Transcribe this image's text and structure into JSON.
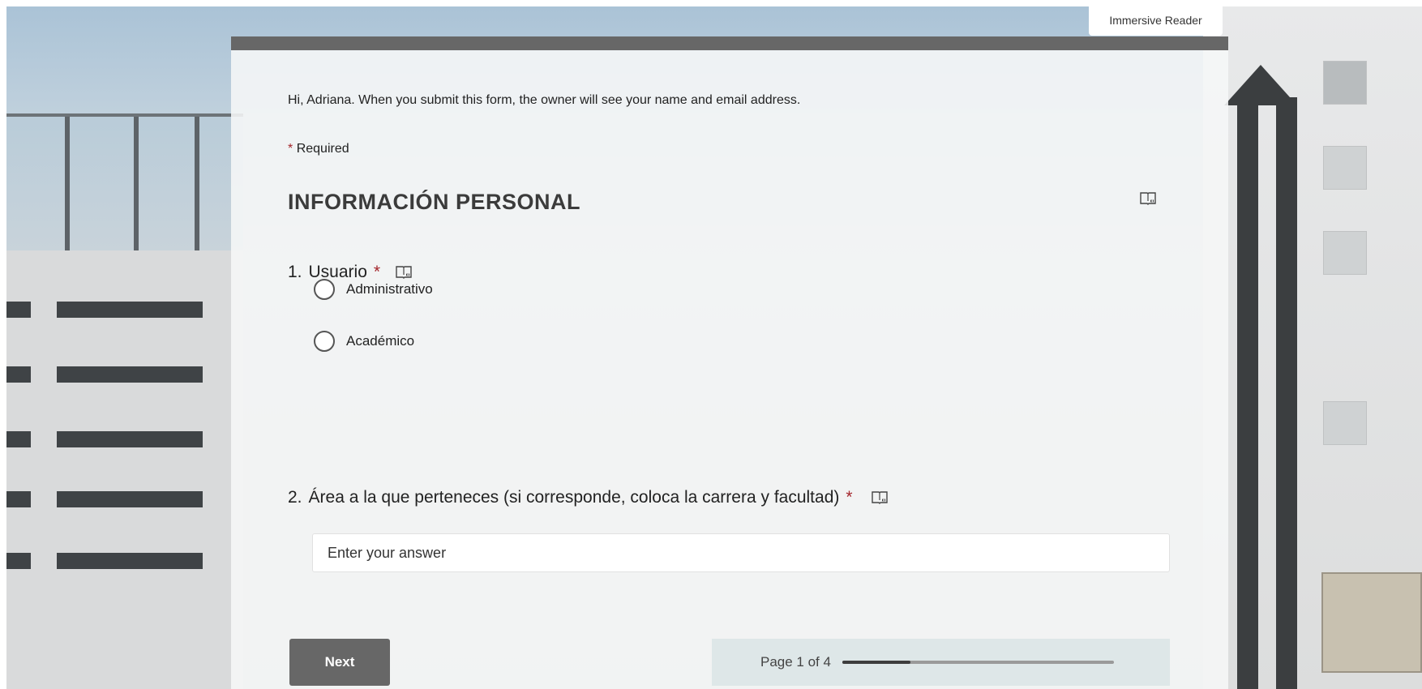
{
  "toolbar": {
    "immersive_reader_label": "Immersive Reader"
  },
  "form": {
    "notice": "Hi, Adriana. When you submit this form, the owner will see your name and email address.",
    "required_star": "*",
    "required_label": "Required",
    "section_title": "INFORMACIÓN PERSONAL",
    "questions": [
      {
        "number": "1.",
        "title": "Usuario",
        "required_star": "*",
        "options": [
          "Administrativo",
          "Académico"
        ]
      },
      {
        "number": "2.",
        "title": "Área a la que perteneces (si corresponde, coloca la carrera y facultad)",
        "required_star": "*",
        "placeholder": "Enter your answer",
        "value": ""
      }
    ],
    "next_label": "Next",
    "page_indicator": "Page 1 of 4",
    "progress_fraction": 0.25
  },
  "colors": {
    "header_bar": "#676767",
    "required_star": "#a4262c",
    "next_button": "#676767"
  },
  "icons": {
    "reader": "immersive-reader-icon"
  }
}
